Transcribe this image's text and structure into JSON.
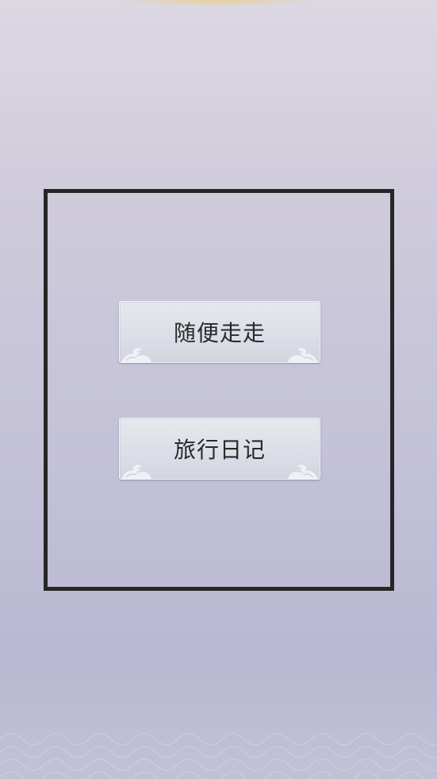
{
  "menu": {
    "buttons": [
      {
        "label": "随便走走"
      },
      {
        "label": "旅行日记"
      }
    ]
  },
  "colors": {
    "background_top": "#dcd8e2",
    "background_bottom": "#b9b8d2",
    "frame_border": "#262626",
    "button_face": "#dcdfe7",
    "button_text": "#2a2a2a"
  },
  "icons": {
    "button_ornament": "cloud-ornament-icon"
  }
}
